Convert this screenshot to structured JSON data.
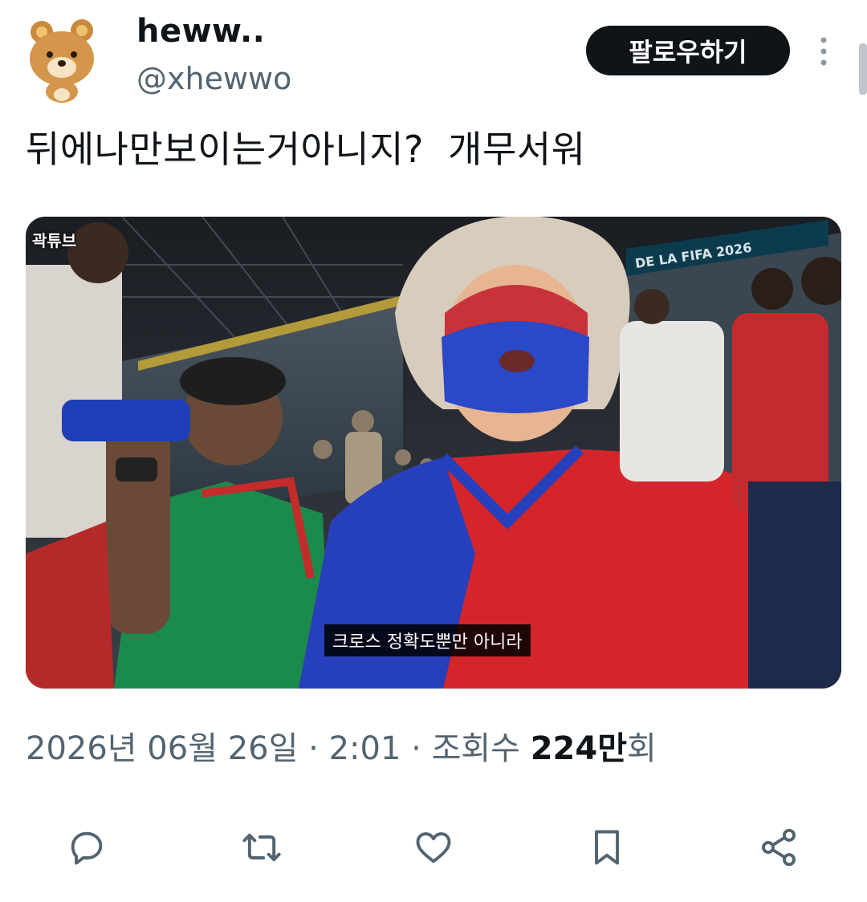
{
  "user": {
    "display_name": "heww..",
    "handle": "@xhewwo",
    "avatar_icon": "bear-avatar"
  },
  "header": {
    "follow_label": "팔로우하기",
    "more_icon": "more-vertical-icon"
  },
  "tweet": {
    "text": "뒤에나만보이는거아니지?  개무서워"
  },
  "media": {
    "watermark": "곽튜브",
    "subtitle": "크로스 정확도뿐만 아니라",
    "banner_text": "DE LA FIFA 2026"
  },
  "meta": {
    "date": "2026년 06월 26일",
    "separator": " · ",
    "time": "2:01",
    "views_label": "조회수",
    "views_count": "224만",
    "views_suffix": "회"
  },
  "actions": {
    "reply_icon": "reply-icon",
    "retweet_icon": "retweet-icon",
    "like_icon": "like-icon",
    "bookmark_icon": "bookmark-icon",
    "share_icon": "share-icon"
  },
  "colors": {
    "text_primary": "#0f1419",
    "text_secondary": "#536471",
    "follow_bg": "#0f1419"
  }
}
